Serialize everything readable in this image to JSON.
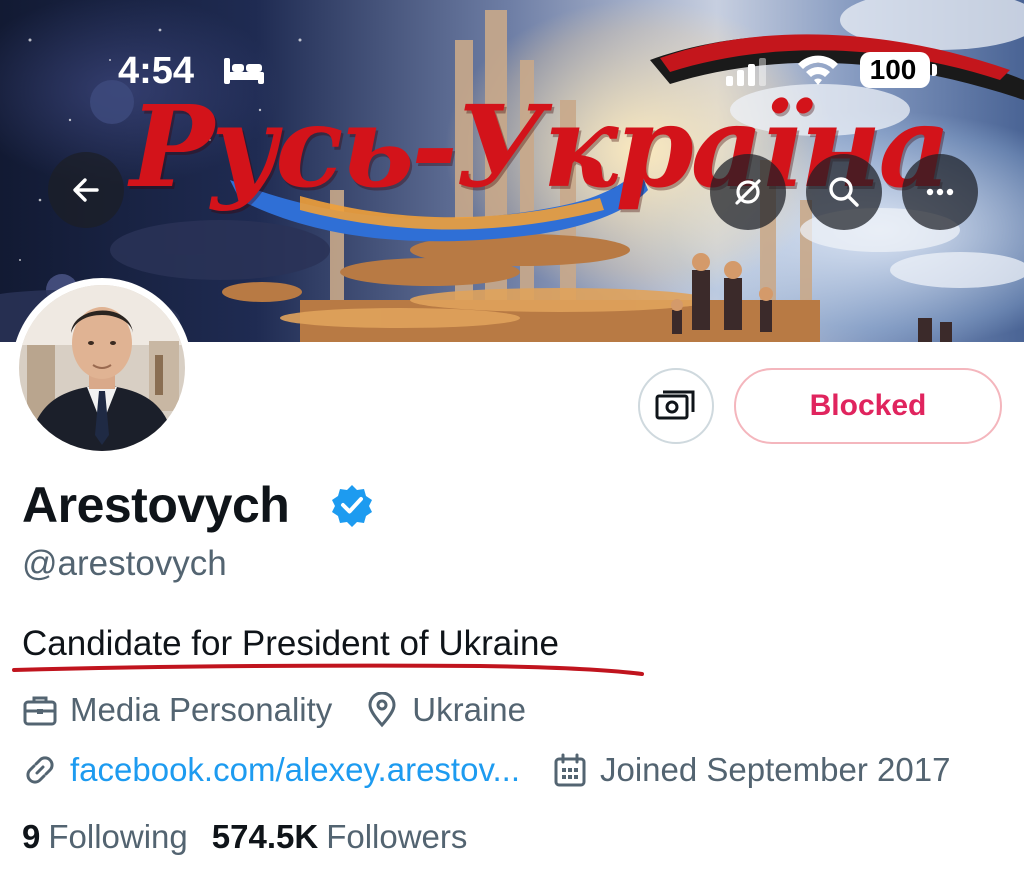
{
  "status_bar": {
    "time": "4:54",
    "battery": "100",
    "icons": [
      "bed-icon",
      "signal-icon",
      "wifi-icon",
      "battery-icon"
    ]
  },
  "banner": {
    "title": "Русь-Украïна"
  },
  "nav": {
    "icons": [
      "back-arrow-icon",
      "hide-icon",
      "search-icon",
      "more-icon"
    ]
  },
  "actions": {
    "money_icon": "money-icon",
    "blocked_label": "Blocked"
  },
  "profile": {
    "display_name": "Arestovych",
    "handle": "@arestovych",
    "bio": "Candidate for President of Ukraine",
    "category": "Media Personality",
    "location": "Ukraine",
    "website": "facebook.com/alexey.arestov...",
    "joined": "Joined September 2017",
    "following_count": "9",
    "following_label": "Following",
    "followers_count": "574.5K",
    "followers_label": "Followers"
  },
  "colors": {
    "link": "#1d9bf0",
    "blocked": "#e0245e",
    "verified": "#1d9bf0",
    "secondary_text": "#536471",
    "underline": "#c0141e"
  }
}
